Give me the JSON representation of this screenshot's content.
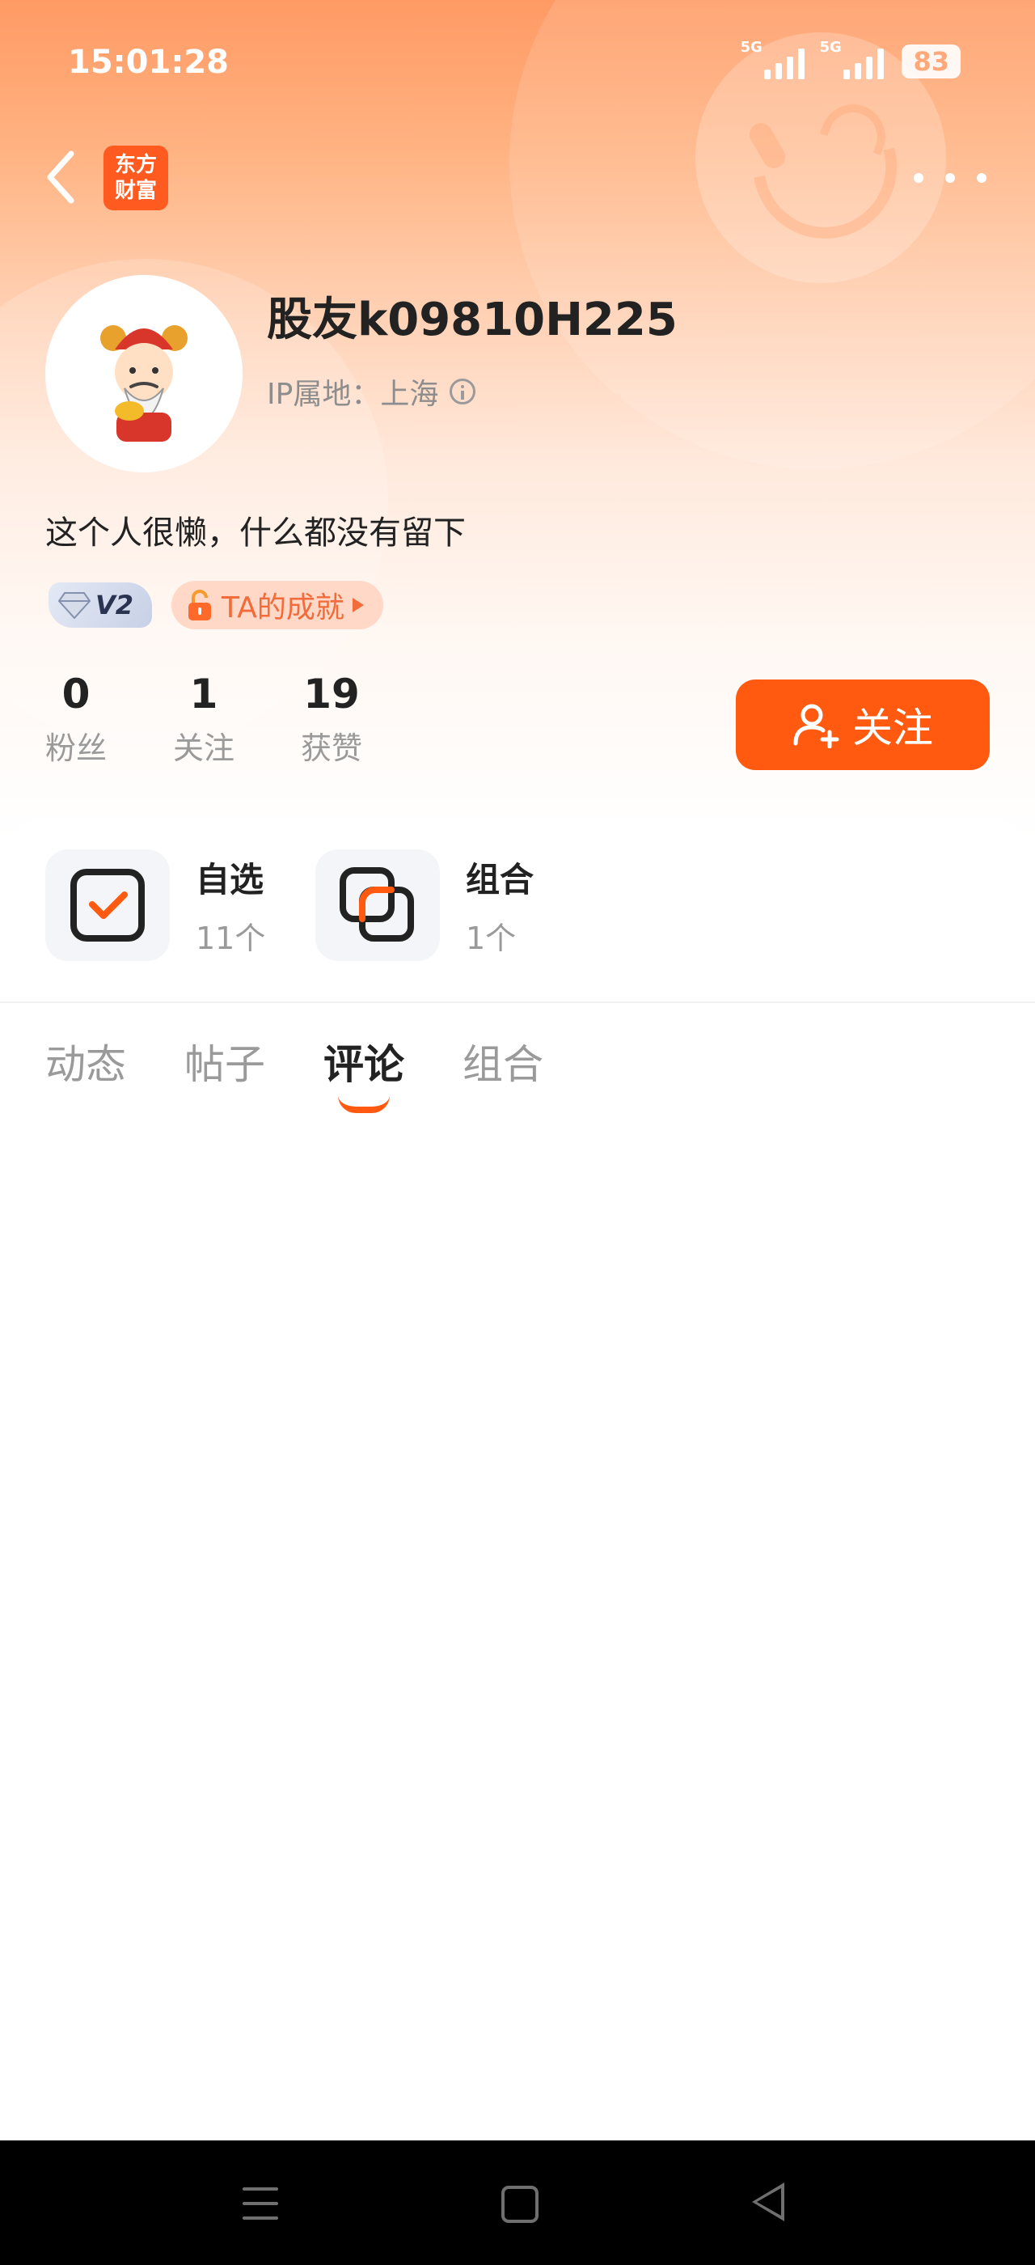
{
  "status_bar": {
    "time": "15:01:28",
    "signal1_label": "5G",
    "signal2_label": "5G",
    "battery": "83"
  },
  "header": {
    "app_logo_line1": "东方",
    "app_logo_line2": "财富"
  },
  "profile": {
    "username": "股友k09810H225",
    "ip_label": "IP属地：上海",
    "bio": "这个人很懒，什么都没有留下",
    "level": "V2",
    "achievement": "TA的成就"
  },
  "stats": [
    {
      "value": "0",
      "label": "粉丝"
    },
    {
      "value": "1",
      "label": "关注"
    },
    {
      "value": "19",
      "label": "获赞"
    }
  ],
  "follow_button": "关注",
  "quick_links": [
    {
      "title": "自选",
      "count": "11个"
    },
    {
      "title": "组合",
      "count": "1个"
    }
  ],
  "tabs": [
    {
      "label": "动态",
      "active": false
    },
    {
      "label": "帖子",
      "active": false
    },
    {
      "label": "评论",
      "active": true
    },
    {
      "label": "组合",
      "active": false
    }
  ],
  "colors": {
    "accent": "#ff5a10",
    "header_top": "#ff9a64"
  }
}
